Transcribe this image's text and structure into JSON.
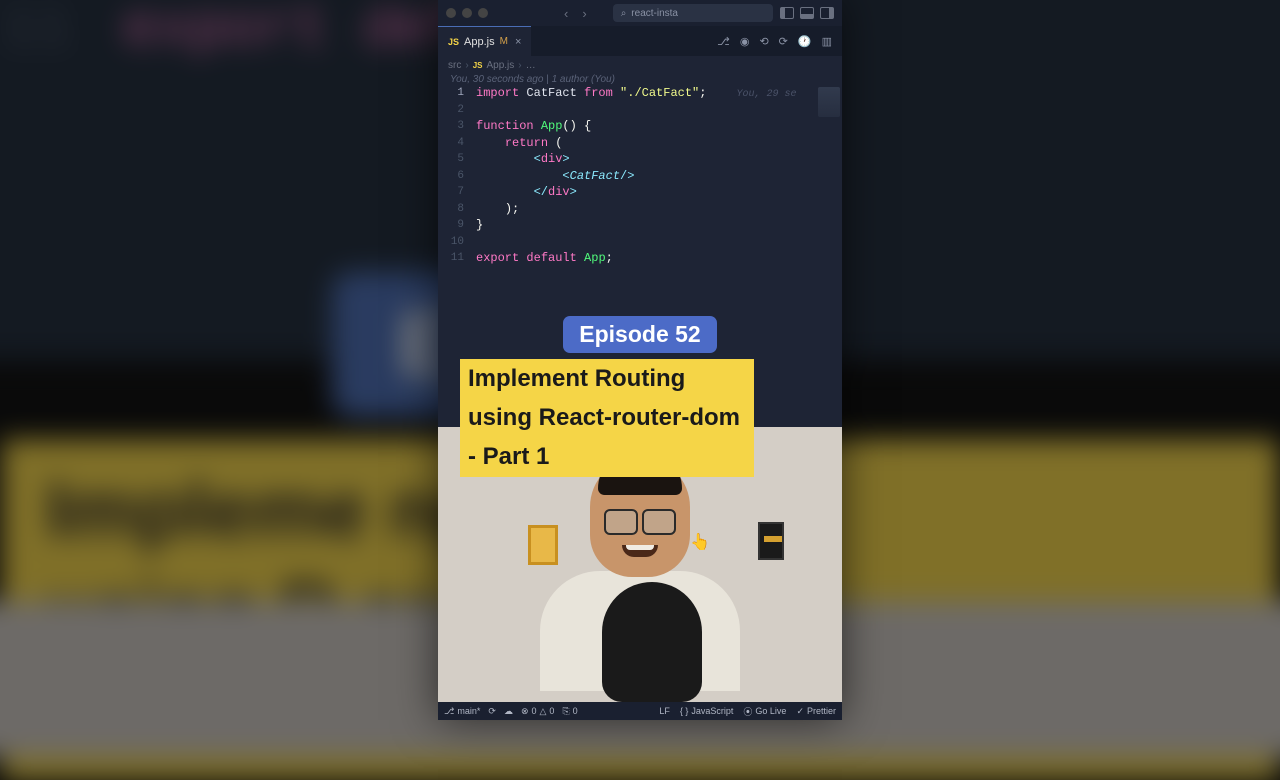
{
  "titlebar": {
    "searchPlaceholder": "react-insta",
    "backIcon": "‹",
    "forwardIcon": "›",
    "searchIcon": "⌕"
  },
  "tab": {
    "jsBadge": "JS",
    "filename": "App.js",
    "modified": "M",
    "close": "×"
  },
  "breadcrumb": {
    "folder": "src",
    "sep": "›",
    "jsBadge": "JS",
    "file": "App.js",
    "sep2": "›",
    "dots": "…"
  },
  "gitlens": {
    "blame": "You, 30 seconds ago | 1 author (You)",
    "inline": "You, 29 se"
  },
  "code": {
    "lines": [
      {
        "n": "1",
        "segs": [
          {
            "c": "kw-import",
            "t": "import"
          },
          {
            "c": "identifier",
            "t": " CatFact "
          },
          {
            "c": "kw-from",
            "t": "from"
          },
          {
            "c": "identifier",
            "t": " "
          },
          {
            "c": "string",
            "t": "\"./CatFact\""
          },
          {
            "c": "semi",
            "t": ";"
          }
        ],
        "blame": true
      },
      {
        "n": "2",
        "segs": []
      },
      {
        "n": "3",
        "segs": [
          {
            "c": "kw-func",
            "t": "function"
          },
          {
            "c": "identifier",
            "t": " "
          },
          {
            "c": "fn-name",
            "t": "App"
          },
          {
            "c": "paren",
            "t": "() {"
          }
        ]
      },
      {
        "n": "4",
        "segs": [
          {
            "c": "identifier",
            "t": "    "
          },
          {
            "c": "kw-return",
            "t": "return"
          },
          {
            "c": "paren",
            "t": " ("
          }
        ]
      },
      {
        "n": "5",
        "segs": [
          {
            "c": "identifier",
            "t": "        "
          },
          {
            "c": "tag-bracket",
            "t": "<"
          },
          {
            "c": "tag-name",
            "t": "div"
          },
          {
            "c": "tag-bracket",
            "t": ">"
          }
        ]
      },
      {
        "n": "6",
        "segs": [
          {
            "c": "identifier",
            "t": "            "
          },
          {
            "c": "tag-bracket",
            "t": "<"
          },
          {
            "c": "tag-comp",
            "t": "CatFact"
          },
          {
            "c": "tag-bracket",
            "t": "/>"
          }
        ]
      },
      {
        "n": "7",
        "segs": [
          {
            "c": "identifier",
            "t": "        "
          },
          {
            "c": "tag-bracket",
            "t": "</"
          },
          {
            "c": "tag-name",
            "t": "div"
          },
          {
            "c": "tag-bracket",
            "t": ">"
          }
        ]
      },
      {
        "n": "8",
        "segs": [
          {
            "c": "identifier",
            "t": "    "
          },
          {
            "c": "paren",
            "t": ");"
          }
        ]
      },
      {
        "n": "9",
        "segs": [
          {
            "c": "paren",
            "t": "}"
          }
        ]
      },
      {
        "n": "10",
        "segs": []
      },
      {
        "n": "11",
        "segs": [
          {
            "c": "kw-export",
            "t": "export"
          },
          {
            "c": "identifier",
            "t": " "
          },
          {
            "c": "kw-default",
            "t": "default"
          },
          {
            "c": "identifier",
            "t": " "
          },
          {
            "c": "fn-name",
            "t": "App"
          },
          {
            "c": "semi",
            "t": ";"
          }
        ]
      }
    ]
  },
  "overlay": {
    "episode": "Episode 52",
    "subtitle1": "Implement Routing",
    "subtitle2": "using React-router-dom",
    "subtitle3": "- Part 1"
  },
  "bgBlur": {
    "lineNum": "11",
    "codeText": "export defau",
    "episode": "E         2",
    "sub1": "Impleme          ng",
    "sub2": "using R          er-dom",
    "sub3": "- Part 1"
  },
  "status": {
    "branch": "main*",
    "sync": "⟳",
    "cloud": "☁",
    "errors": "0",
    "warnings": "0",
    "ports": "0",
    "lf": "LF",
    "lang": "JavaScript",
    "golive": "Go Live",
    "prettier": "Prettier",
    "radioIcon": "⦿",
    "errIcon": "⊗",
    "warnIcon": "△",
    "portIcon": "⎘",
    "braces": "{ }",
    "check": "✓"
  }
}
